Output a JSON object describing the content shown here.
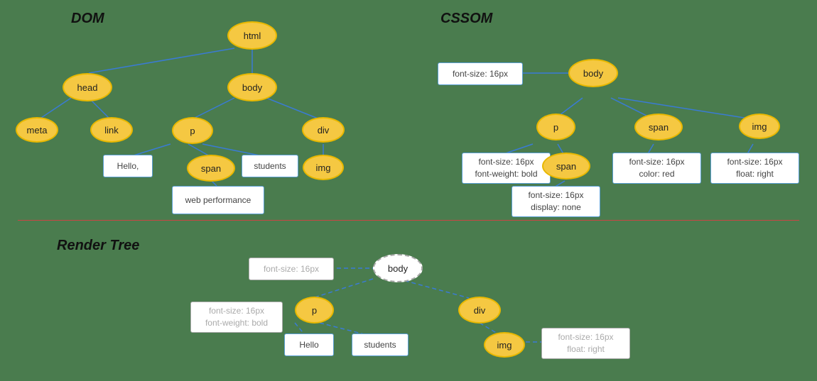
{
  "sections": {
    "dom": {
      "title": "DOM",
      "nodes": {
        "html": {
          "label": "html"
        },
        "head": {
          "label": "head"
        },
        "body": {
          "label": "body"
        },
        "meta": {
          "label": "meta"
        },
        "link": {
          "label": "link"
        },
        "p": {
          "label": "p"
        },
        "div": {
          "label": "div"
        },
        "span": {
          "label": "span"
        },
        "img": {
          "label": "img"
        },
        "hello": {
          "label": "Hello,"
        },
        "students": {
          "label": "students"
        },
        "web_performance": {
          "label": "web performance"
        }
      }
    },
    "cssom": {
      "title": "CSSOM",
      "nodes": {
        "body": {
          "label": "body"
        },
        "p": {
          "label": "p"
        },
        "span_outer": {
          "label": "span"
        },
        "img": {
          "label": "img"
        },
        "span_inner": {
          "label": "span"
        },
        "rule_body": {
          "label": "font-size: 16px"
        },
        "rule_p": {
          "label": "font-size: 16px\nfont-weight: bold"
        },
        "rule_span_outer": {
          "label": "font-size: 16px\ncolor: red"
        },
        "rule_img": {
          "label": "font-size: 16px\nfloat: right"
        },
        "rule_span_inner": {
          "label": "font-size: 16px\ndisplay: none"
        }
      }
    },
    "render_tree": {
      "title": "Render Tree",
      "nodes": {
        "body": {
          "label": "body"
        },
        "p": {
          "label": "p"
        },
        "div": {
          "label": "div"
        },
        "img": {
          "label": "img"
        },
        "hello": {
          "label": "Hello"
        },
        "students": {
          "label": "students"
        },
        "rule_body": {
          "label": "font-size: 16px"
        },
        "rule_p": {
          "label": "font-size: 16px\nfont-weight: bold"
        },
        "rule_img": {
          "label": "font-size: 16px\nfloat: right"
        }
      }
    }
  }
}
